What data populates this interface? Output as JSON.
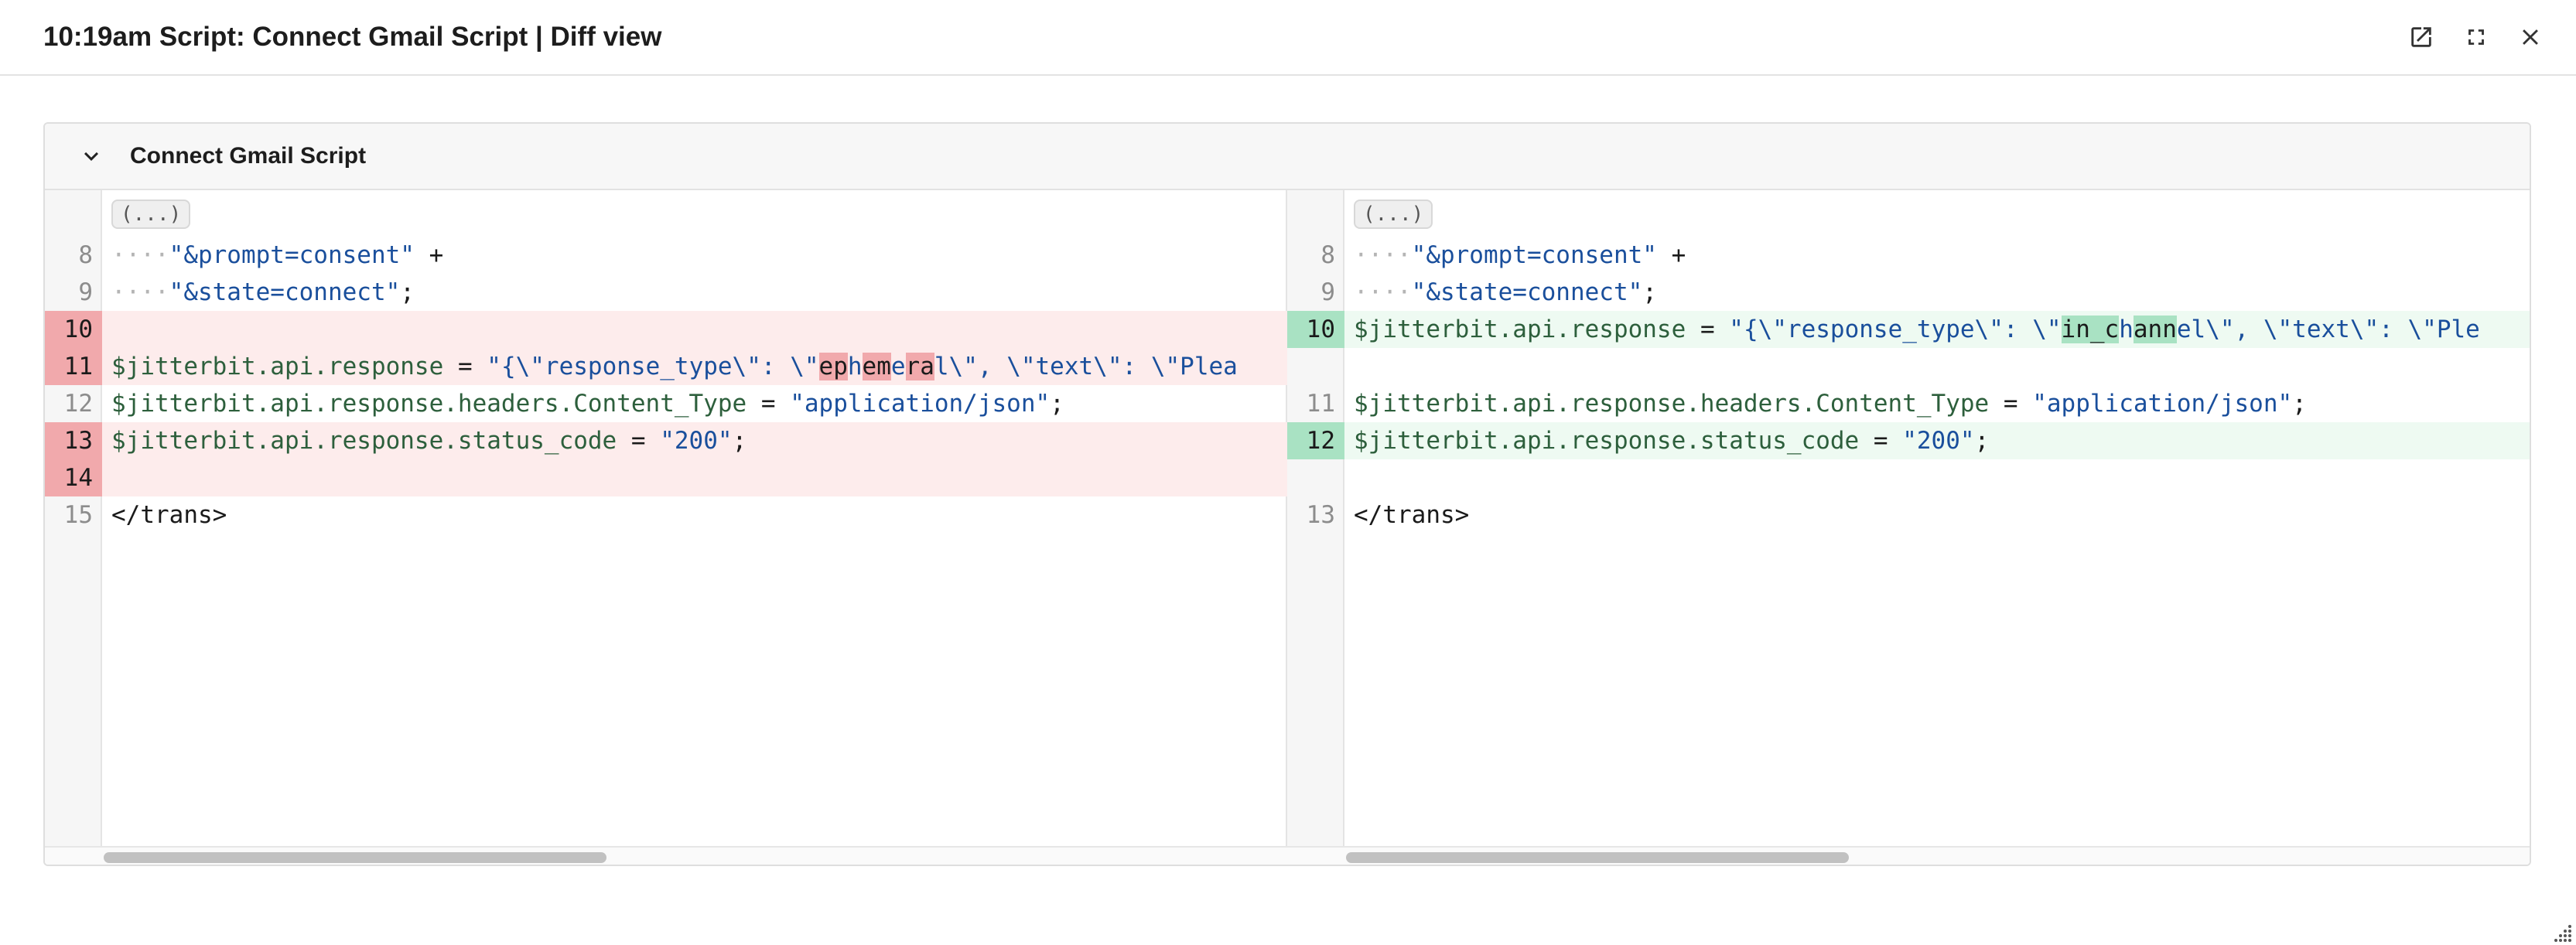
{
  "window": {
    "title": "10:19am Script: Connect Gmail Script | Diff view",
    "actions": [
      {
        "icon": "open-in-new-icon"
      },
      {
        "icon": "fullscreen-icon"
      },
      {
        "icon": "close-icon"
      }
    ]
  },
  "panel": {
    "title": "Connect Gmail Script",
    "toggle_icon": "chevron-down-icon",
    "left": {
      "fold": "(...)",
      "lines": [
        {
          "num": "8",
          "code": "····\"&prompt=consent\" +"
        },
        {
          "num": "9",
          "code": "····\"&state=connect\";"
        },
        {
          "num": "10",
          "code": "",
          "status": "deleted"
        },
        {
          "num": "11",
          "code": "$jitterbit.api.response = \"{\\\"response_type\\\": \\\"ephemeral\\\", \\\"text\\\": \\\"Plea",
          "status": "deleted"
        },
        {
          "num": "12",
          "code": "$jitterbit.api.response.headers.Content_Type = \"application/json\";"
        },
        {
          "num": "13",
          "code": "$jitterbit.api.response.status_code = \"200\";",
          "status": "deleted"
        },
        {
          "num": "14",
          "code": "",
          "status": "deleted"
        },
        {
          "num": "15",
          "code": "</trans>"
        }
      ]
    },
    "right": {
      "fold": "(...)",
      "lines": [
        {
          "num": "8",
          "code": "····\"&prompt=consent\" +"
        },
        {
          "num": "9",
          "code": "····\"&state=connect\";"
        },
        {
          "num": "10",
          "code": "$jitterbit.api.response = \"{\\\"response_type\\\": \\\"in_channel\\\", \\\"text\\\": \\\"Ple",
          "status": "added"
        },
        {
          "num": "",
          "code": ""
        },
        {
          "num": "11",
          "code": "$jitterbit.api.response.headers.Content_Type = \"application/json\";"
        },
        {
          "num": "12",
          "code": "$jitterbit.api.response.status_code = \"200\";",
          "status": "added"
        },
        {
          "num": "",
          "code": ""
        },
        {
          "num": "13",
          "code": "</trans>"
        }
      ]
    }
  },
  "colors": {
    "deleted_bg": "#fdecec",
    "deleted_gutter": "#f1a9ac",
    "added_bg": "#eefaf2",
    "added_gutter": "#a9e2c3",
    "string": "#1a4f9c",
    "identifier": "#2d5f3c"
  }
}
